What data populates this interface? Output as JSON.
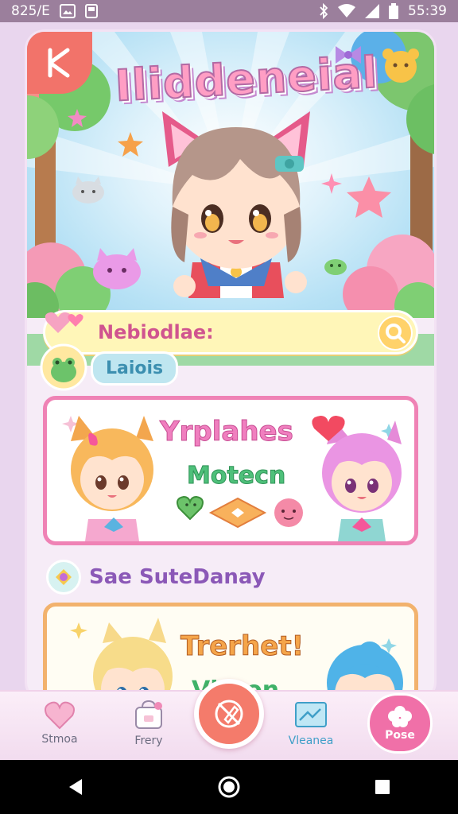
{
  "status_bar": {
    "time_left": "825/E",
    "time_right": "55:39"
  },
  "app": {
    "title": "Iliddeneial",
    "search_label": "Nebiodlae:",
    "tag_label": "Laiois",
    "feature": {
      "title": "Yrplahes",
      "subtitle": "Motecn"
    },
    "section_title": "Sae SuteDanay",
    "news": {
      "title": "Trerhet!",
      "subtitle": "Vltaon"
    }
  },
  "tab_bar": {
    "tabs": [
      {
        "label": "Stmoa",
        "icon": "heart-icon"
      },
      {
        "label": "Frery",
        "icon": "shop-icon"
      },
      {
        "label": "Vleanea",
        "icon": "news-icon"
      }
    ],
    "center_icon": "no-pen-icon",
    "more_label": "Pose"
  },
  "colors": {
    "accent_pink": "#f070a8",
    "coral": "#f47b6b",
    "status_bar": "#9b7f9c"
  }
}
